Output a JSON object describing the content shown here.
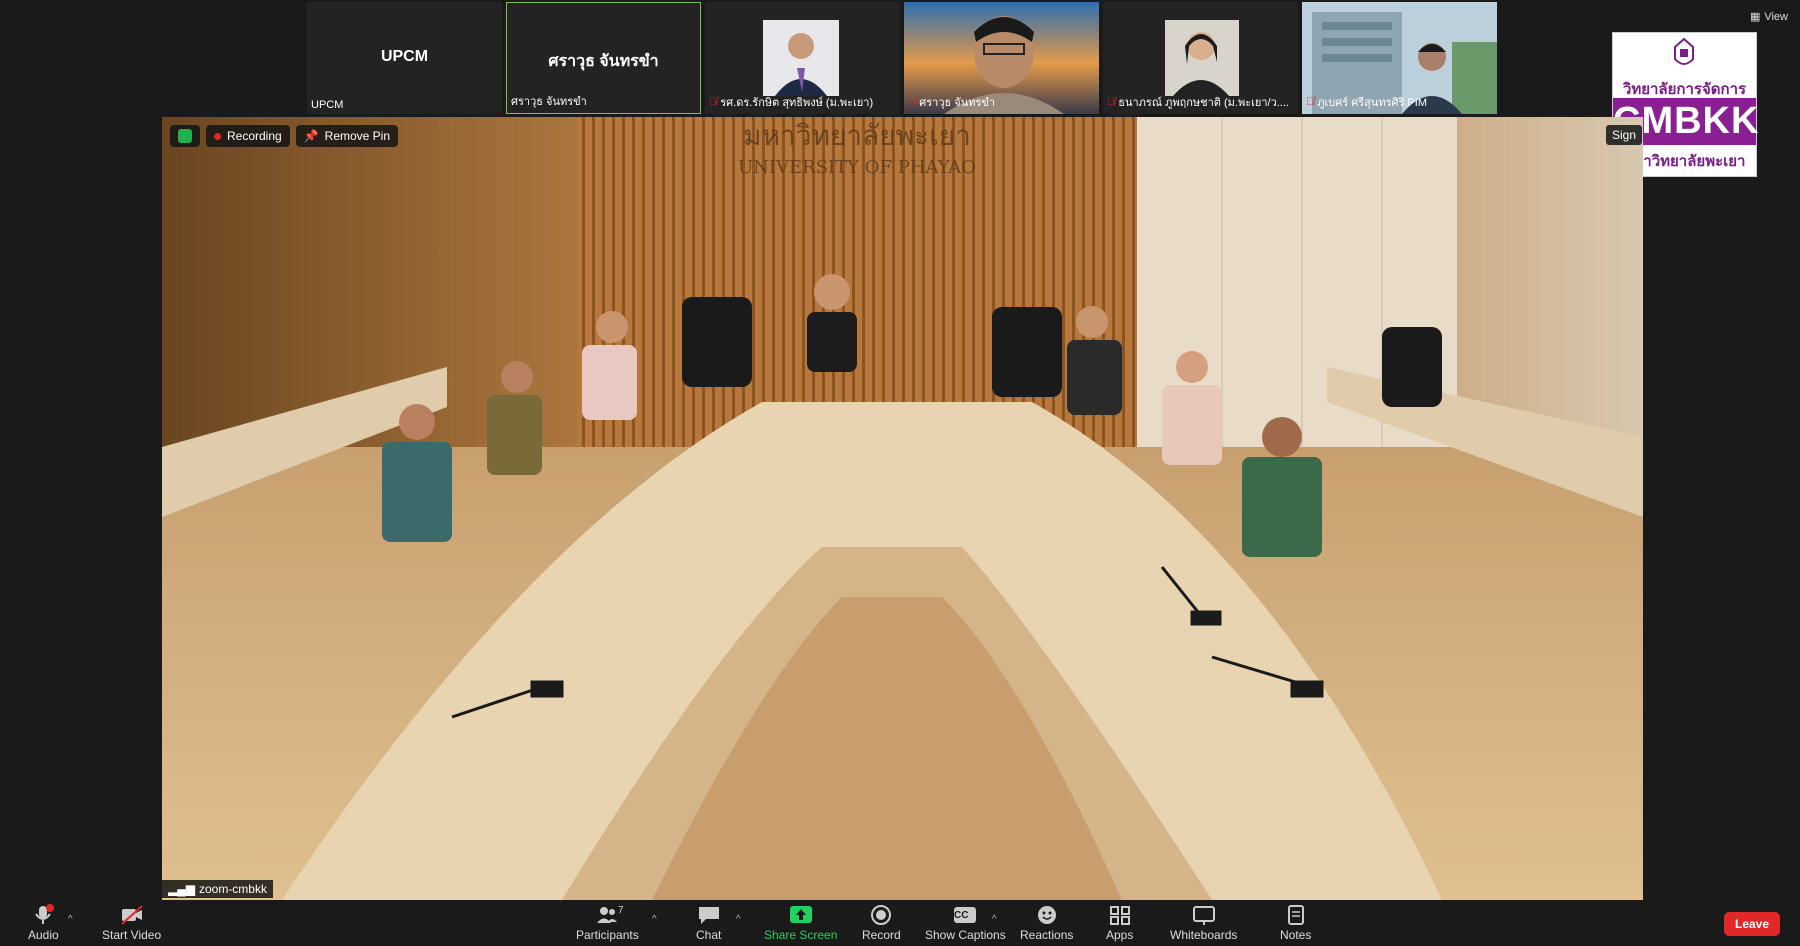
{
  "gallery": {
    "tiles": [
      {
        "big": "UPCM",
        "name": "UPCM",
        "muted": false
      },
      {
        "big": "ศราวุธ จันทรขำ",
        "name": "ศราวุธ จันทรขำ",
        "muted": false
      },
      {
        "name": "รศ.ดร.รักษิต สุทธิพงษ์ (ม.พะเยา)",
        "muted": true
      },
      {
        "name": "ศราวุธ จันทรขำ",
        "muted": true
      },
      {
        "name": "ธนาภรณ์ ภูพฤกษชาติ (ม.พะเยา/ว....",
        "muted": true
      },
      {
        "name": "ภูเบศร์ ศรีสุนทรศิริ PIM",
        "muted": true
      }
    ],
    "view_label": "View"
  },
  "logo": {
    "line1": "วิทยาลัยการจัดการ",
    "brand": "CMBKK",
    "line2": "มหาวิทยาลัยพะเยา"
  },
  "main_video": {
    "recording_label": "Recording",
    "remove_pin_label": "Remove Pin",
    "sign_label": "Sign",
    "wall_text_th": "มหาวิทยาลัยพะเยา",
    "wall_text_en": "UNIVERSITY OF PHAYAO",
    "participant_name": "zoom-cmbkk"
  },
  "toolbar": {
    "audio": "Audio",
    "audio_badge": "!",
    "start_video": "Start Video",
    "participants": "Participants",
    "participants_count": "7",
    "chat": "Chat",
    "share_screen": "Share Screen",
    "record": "Record",
    "show_captions": "Show Captions",
    "cc": "CC",
    "reactions": "Reactions",
    "apps": "Apps",
    "whiteboards": "Whiteboards",
    "notes": "Notes",
    "leave": "Leave"
  },
  "colors": {
    "accent_green": "#23d160",
    "record_red": "#e02828",
    "brand_purple": "#8a1f94"
  }
}
